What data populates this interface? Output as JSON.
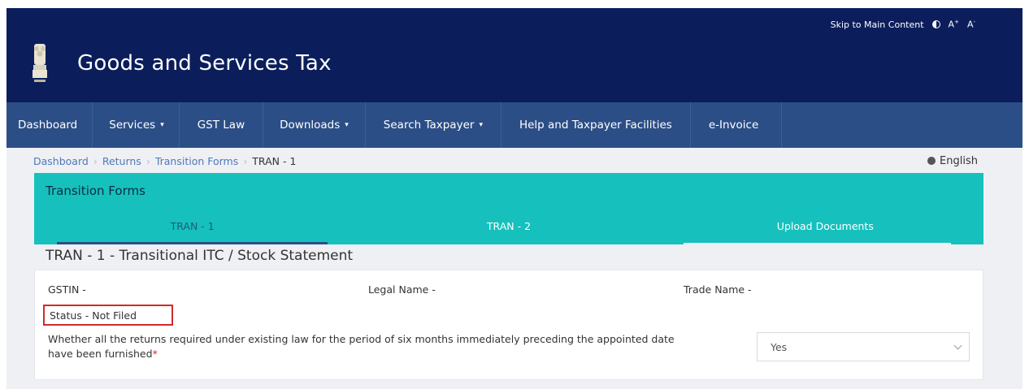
{
  "header": {
    "skip_link": "Skip to Main Content",
    "font_increase": "A",
    "font_increase_sup": "+",
    "font_decrease": "A",
    "font_decrease_sup": "-",
    "title": "Goods and Services Tax",
    "bg_color": "#0b1e5b"
  },
  "nav": {
    "items": [
      {
        "label": "Dashboard",
        "dropdown": ""
      },
      {
        "label": "Services",
        "dropdown": "▾"
      },
      {
        "label": "GST Law",
        "dropdown": ""
      },
      {
        "label": "Downloads",
        "dropdown": "▾"
      },
      {
        "label": "Search Taxpayer",
        "dropdown": "▾"
      },
      {
        "label": "Help and Taxpayer Facilities",
        "dropdown": ""
      },
      {
        "label": "e-Invoice",
        "dropdown": ""
      }
    ],
    "bg_color": "#2c4e86"
  },
  "breadcrumb": {
    "items": [
      "Dashboard",
      "Returns",
      "Transition Forms"
    ],
    "current": "TRAN - 1"
  },
  "language": {
    "label": "English",
    "icon": "globe-icon"
  },
  "transition_forms": {
    "title": "Transition Forms",
    "tabs": [
      "TRAN - 1",
      "TRAN - 2",
      "Upload Documents"
    ],
    "active_tab": 0,
    "bg_color": "#16c1bd"
  },
  "form": {
    "heading": "TRAN - 1 - Transitional ITC / Stock Statement",
    "gstin_label": "GSTIN -",
    "legal_name_label": "Legal Name -",
    "trade_name_label": "Trade Name -",
    "status_label": "Status - Not Filed",
    "question": "Whether all the returns required under existing law for the period of six months immediately preceding the appointed date have been furnished",
    "required_marker": "*",
    "answer_selected": "Yes"
  }
}
